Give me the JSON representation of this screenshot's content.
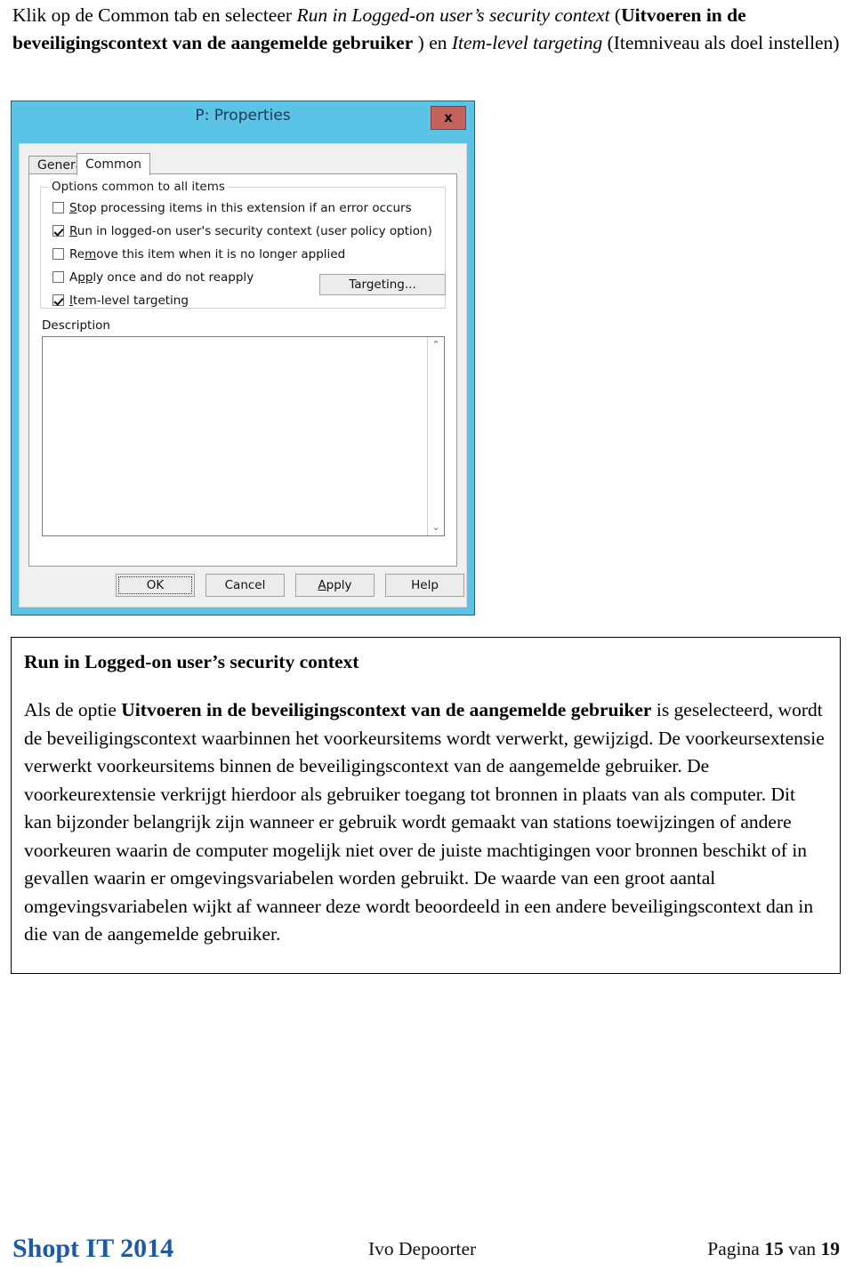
{
  "intro": {
    "part1": "Klik op de Common tab en selecteer ",
    "em1": "Run in Logged-on user’s security context",
    "part2": " (",
    "strong1": "Uitvoeren in de beveiligingscontext van de aangemelde gebruiker",
    "part3": " ) en ",
    "em2": "Item-level targeting",
    "part4": " (Itemniveau als doel instellen)"
  },
  "dialog": {
    "title": "P: Properties",
    "close_label": "x",
    "tabs": [
      {
        "label": "General",
        "active": false
      },
      {
        "label": "Common",
        "active": true
      }
    ],
    "groupbox_title": "Options common to all items",
    "options": [
      {
        "label_pre": "",
        "label_key": "S",
        "label_post": "top processing items in this extension if an error occurs",
        "checked": false
      },
      {
        "label_pre": "",
        "label_key": "R",
        "label_post": "un in logged-on user's security context (user policy option)",
        "checked": true
      },
      {
        "label_pre": "Re",
        "label_key": "m",
        "label_post": "ove this item when it is no longer applied",
        "checked": false
      },
      {
        "label_pre": "A",
        "label_key": "pp",
        "label_post": "ly once and do not reapply",
        "checked": false
      },
      {
        "label_pre": "",
        "label_key": "I",
        "label_post": "tem-level targeting",
        "checked": true
      }
    ],
    "targeting_button": {
      "key": "T",
      "rest": "argeting..."
    },
    "description_label_key": "D",
    "description_label_rest": "escription",
    "description_value": "",
    "scroll_up_glyph": "⌃",
    "scroll_down_glyph": "⌄",
    "buttons": [
      {
        "label": "OK",
        "key": "",
        "rest": "OK",
        "focused": true
      },
      {
        "label": "Cancel",
        "key": "",
        "rest": "Cancel",
        "focused": false
      },
      {
        "label": "Apply",
        "key": "A",
        "rest": "pply",
        "focused": false
      },
      {
        "label": "Help",
        "key": "",
        "rest": "Help",
        "focused": false
      }
    ],
    "colors": {
      "window_border": "#5bc3e6",
      "close_button": "#c4635c",
      "dialog_face": "#f0f0f0"
    }
  },
  "article": {
    "heading": "Run in Logged-on user’s security context",
    "body_pre": "Als de optie ",
    "body_strong": "Uitvoeren in de beveiligingscontext van de aangemelde gebruiker",
    "body_post": " is geselecteerd, wordt de beveiligingscontext waarbinnen het voorkeursitems wordt verwerkt, gewijzigd. De voorkeursextensie verwerkt voorkeursitems binnen de beveiligingscontext van de aangemelde gebruiker. De voorkeurextensie verkrijgt hierdoor als gebruiker toegang tot bronnen in plaats van als computer. Dit kan bijzonder belangrijk zijn wanneer er gebruik wordt gemaakt van stations toewijzingen of andere voorkeuren waarin de computer mogelijk niet over de juiste machtigingen voor bronnen beschikt of in gevallen waarin er omgevingsvariabelen worden gebruikt. De waarde van een groot aantal omgevingsvariabelen wijkt af wanneer deze wordt beoordeeld in een andere beveiligingscontext dan in die van de aangemelde gebruiker."
  },
  "footer": {
    "brand": "Shopt IT 2014",
    "author": "Ivo Depoorter",
    "page_pre": "Pagina ",
    "page_number": "15",
    "page_mid": " van ",
    "page_total": "19",
    "brand_color": "#1c5ba4"
  }
}
